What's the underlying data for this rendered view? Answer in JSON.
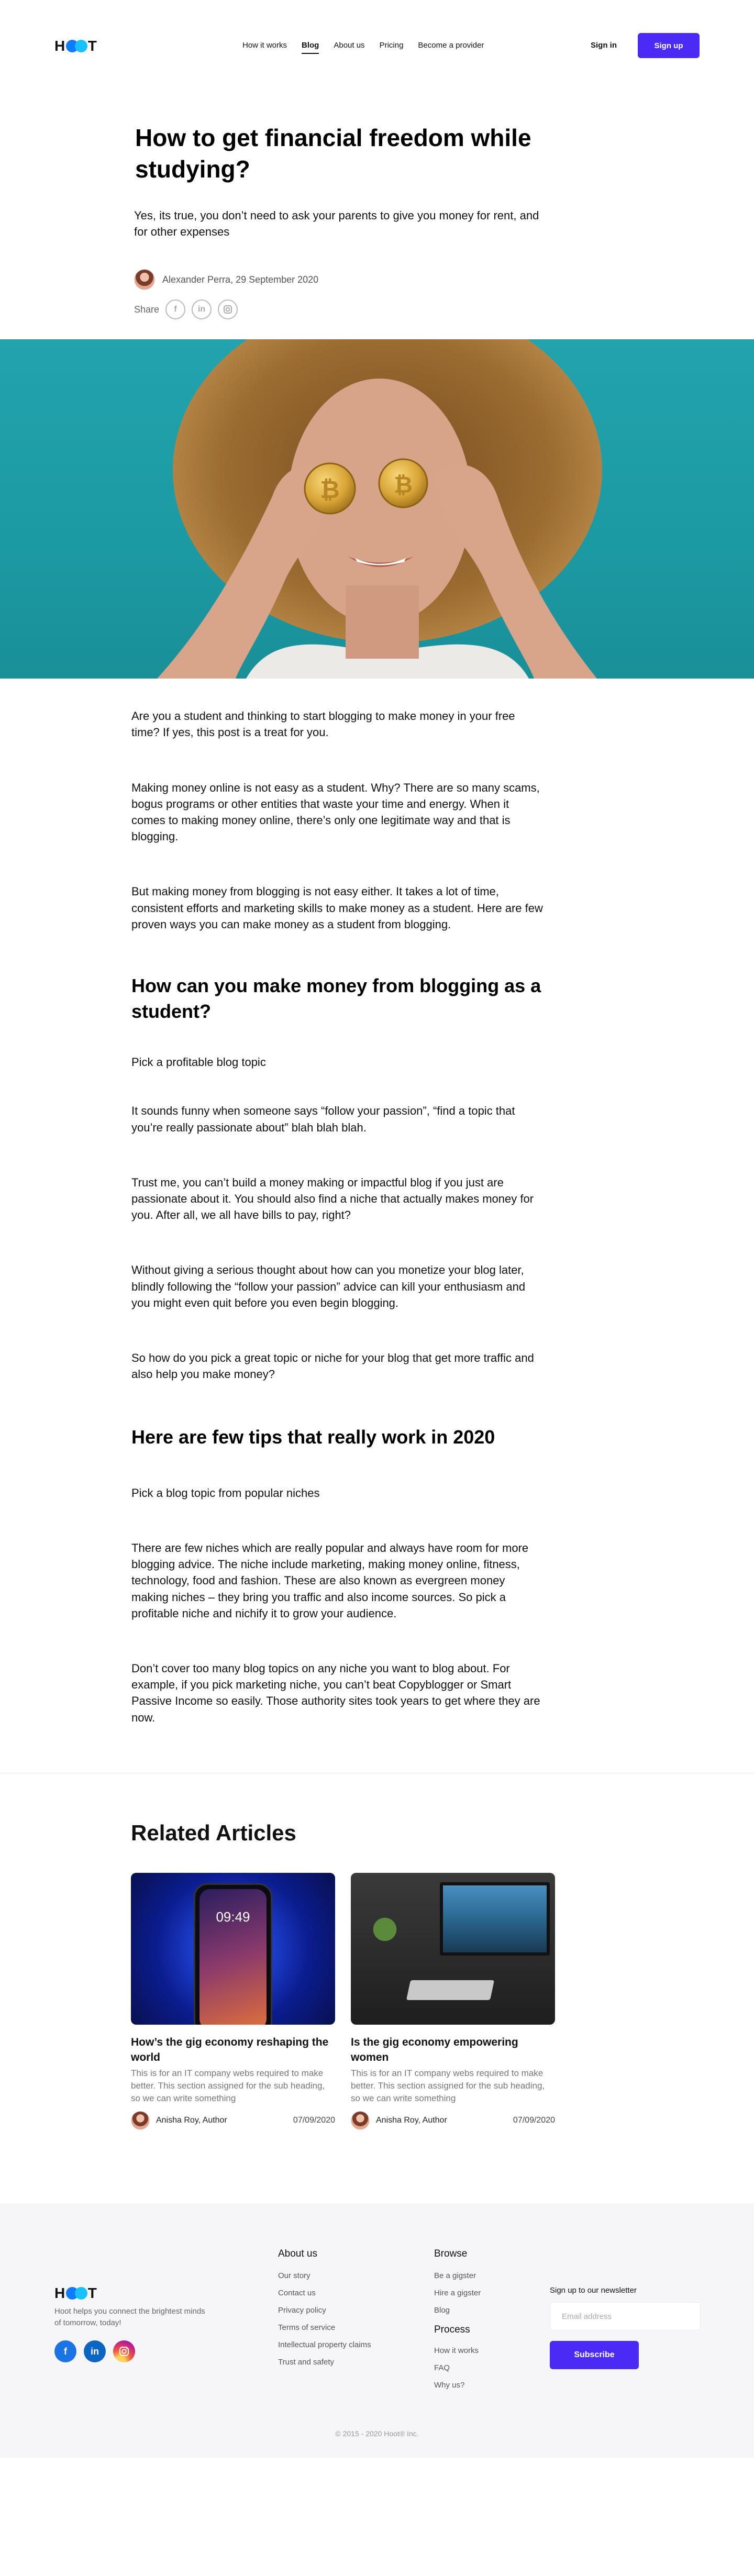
{
  "header": {
    "logo_text": "HOOT",
    "nav": [
      "How it works",
      "Blog",
      "About us",
      "Pricing",
      "Become a provider"
    ],
    "active_nav": "Blog",
    "sign_in": "Sign in",
    "sign_up": "Sign up"
  },
  "article": {
    "title": "How to get financial freedom while studying?",
    "subtitle": "Yes, its true, you don’t need to ask your parents to give you money for rent, and for other expenses",
    "byline": "Alexander Perra, 29 September 2020",
    "share_label": "Share",
    "share_icons": [
      "facebook-icon",
      "linkedin-icon",
      "instagram-icon"
    ]
  },
  "body": {
    "p1": "Are you a student and thinking to start blogging to make money in your free time? If yes, this post is a treat for you.",
    "p2": "Making money online is not easy as a student. Why? There are so many scams, bogus programs or other entities that waste your time and energy. When it comes to making money online, there’s only one legitimate way and that is blogging.",
    "p3": "But making money from blogging is not easy either. It takes a lot of time, consistent efforts and marketing skills to make money as a student. Here are few proven ways you can make money as a student from blogging.",
    "h1": "How can you make money from blogging as a student?",
    "p4": "Pick a profitable blog topic",
    "p5": "It sounds funny when someone says “follow your passion”, “find a topic that you’re really passionate about” blah blah blah.",
    "p6": "Trust me, you can’t build a money making or impactful blog if you just are passionate about it. You should also find a niche that actually makes money for you. After all, we all have bills to pay, right?",
    "p7": "Without giving a serious thought about how can you monetize your blog later, blindly following the “follow your passion” advice can kill your enthusiasm and you might even quit before you even begin blogging.",
    "p8": "So how do you pick a great topic or niche for your blog that get more traffic and also help you make money?",
    "h2": "Here are few tips that really work in 2020",
    "p9": "Pick a blog topic from popular niches",
    "p10": "There are few niches which are really popular and always have room for more blogging advice. The niche include marketing, making money online, fitness, technology, food and fashion. These are also known as evergreen money making niches – they bring you traffic and also income sources. So pick a profitable niche and nichify it to grow your audience.",
    "p11": "Don’t cover too many blog topics on any niche you want to blog about. For example, if you pick marketing niche, you can’t beat Copyblogger or Smart Passive Income so easily. Those authority sites took years to get where they are now."
  },
  "related": {
    "heading": "Related Articles",
    "cards": [
      {
        "title": "How’s the gig economy reshaping the world",
        "desc": "This is for an IT company webs required to make better. This section assigned for the sub heading, so we can write something",
        "author": "Anisha Roy, Author",
        "date": "07/09/2020",
        "phone_time": "09:49"
      },
      {
        "title": "Is the gig economy empowering women",
        "desc": "This is for an IT company webs required to make better. This section assigned for the sub heading, so we can write something",
        "author": "Anisha Roy, Author",
        "date": "07/09/2020"
      }
    ]
  },
  "footer": {
    "logo_text": "HOOT",
    "tagline": "Hoot helps you connect the brightest minds of tomorrow, today!",
    "about_heading": "About us",
    "about_links": [
      "Our story",
      "Contact us",
      "Privacy policy",
      "Terms of service",
      "Intellectual property claims",
      "Trust and safety"
    ],
    "browse_heading": "Browse",
    "browse_links": [
      "Be a gigster",
      "Hire a gigster",
      "Blog"
    ],
    "process_heading": "Process",
    "process_links": [
      "How it works",
      "FAQ",
      "Why us?"
    ],
    "newsletter_label": "Sign up to our newsletter",
    "email_placeholder": "Email address",
    "subscribe": "Subscribe",
    "copyright": "© 2015 - 2020 Hoot® Inc."
  },
  "colors": {
    "brand_purple": "#4a2af4",
    "logo_blue": "#0f7bff",
    "logo_cyan": "#18c1ff",
    "hero_teal": "#1f9ea8"
  }
}
